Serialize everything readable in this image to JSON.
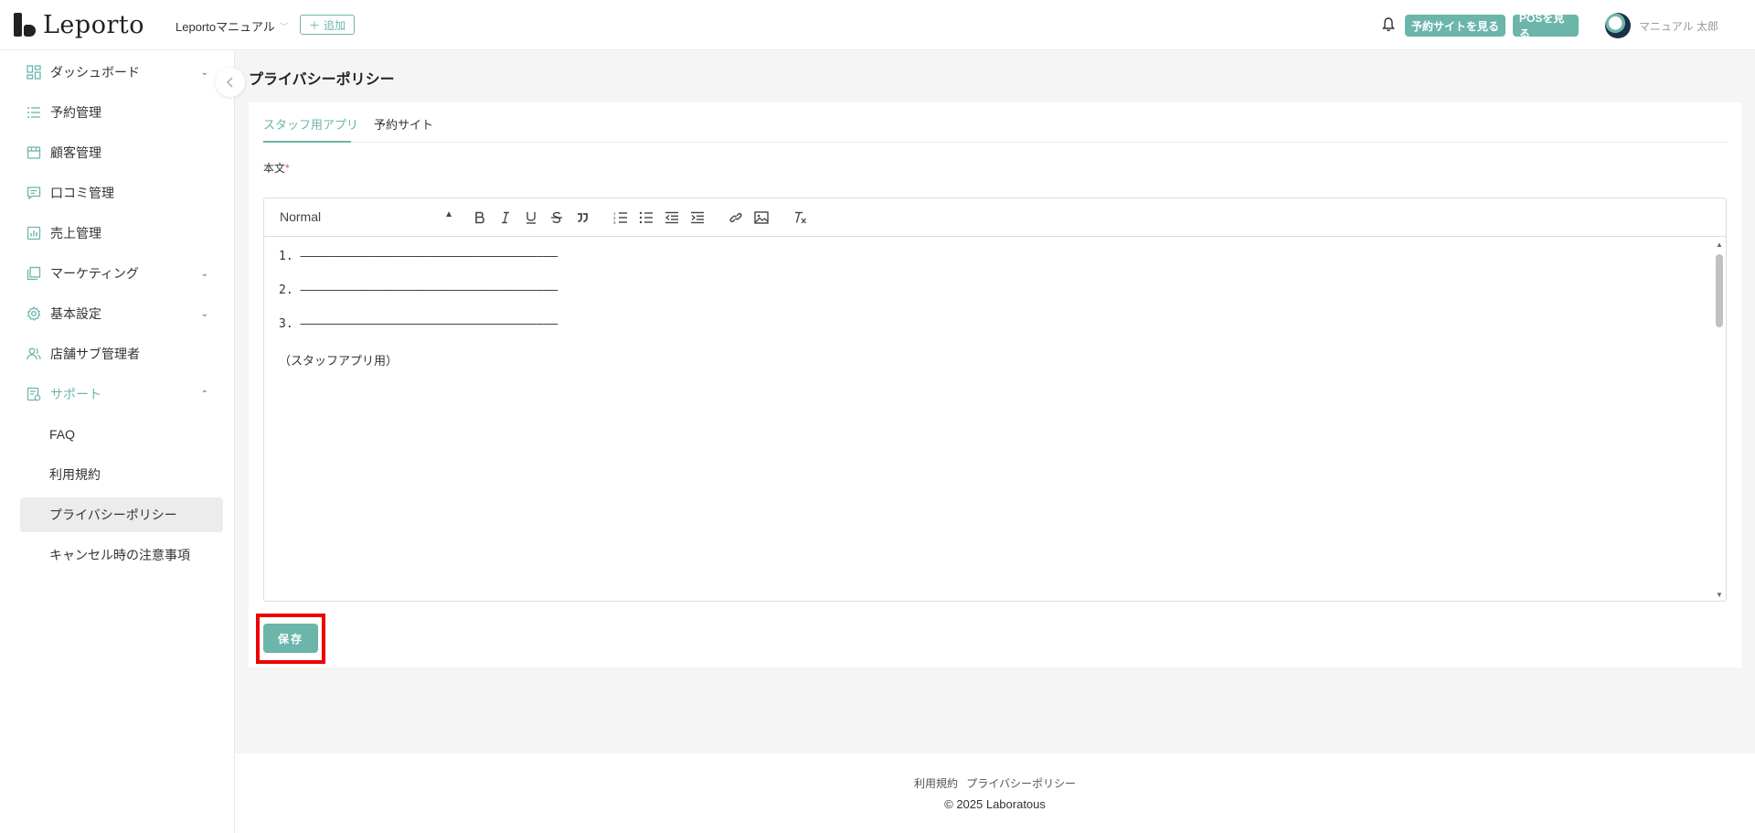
{
  "header": {
    "logo_text": "Leporto",
    "store_name": "Leportoマニュアル",
    "add_label": "追加",
    "reserve_site_button": "予約サイトを見る",
    "pos_button": "POSを見る",
    "user_name": "マニュアル 太郎"
  },
  "sidebar": {
    "items": [
      {
        "label": "ダッシュボード",
        "icon": "dashboard-icon",
        "has_chevron": true
      },
      {
        "label": "予約管理",
        "icon": "list-icon"
      },
      {
        "label": "顧客管理",
        "icon": "store-icon"
      },
      {
        "label": "口コミ管理",
        "icon": "comment-icon"
      },
      {
        "label": "売上管理",
        "icon": "bar-chart-icon"
      },
      {
        "label": "マーケティング",
        "icon": "layers-icon",
        "has_chevron": true
      },
      {
        "label": "基本設定",
        "icon": "gear-icon",
        "has_chevron": true
      },
      {
        "label": "店舗サブ管理者",
        "icon": "users-icon"
      },
      {
        "label": "サポート",
        "icon": "support-icon",
        "has_chevron": true,
        "expanded": true
      }
    ],
    "sub_items": [
      {
        "label": "FAQ"
      },
      {
        "label": "利用規約"
      },
      {
        "label": "プライバシーポリシー",
        "selected": true
      },
      {
        "label": "キャンセル時の注意事項"
      }
    ]
  },
  "main": {
    "page_title": "プライバシーポリシー",
    "tabs": [
      {
        "label": "スタッフ用アプリ",
        "active": true
      },
      {
        "label": "予約サイト"
      }
    ],
    "field_label": "本文",
    "required_mark": "*",
    "editor": {
      "format_value": "Normal",
      "lines": [
        "1. ————————————————————————————————————",
        "2. ————————————————————————————————————",
        "3. ————————————————————————————————————",
        "（スタッフアプリ用）"
      ]
    },
    "save_label": "保存"
  },
  "footer": {
    "links": [
      "利用規約",
      "プライバシーポリシー"
    ],
    "copyright": "2025 Laboratous"
  },
  "colors": {
    "accent": "#6bb5aa",
    "highlight": "#ee0000"
  }
}
